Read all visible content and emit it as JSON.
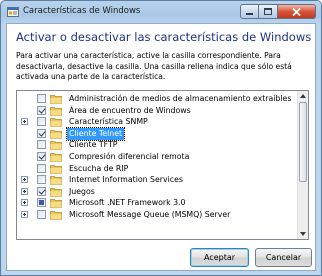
{
  "window": {
    "title": "Características de Windows",
    "controls": {
      "minimize": "minimize-icon",
      "maximize": "maximize-icon",
      "close": "close-icon"
    }
  },
  "heading": "Activar o desactivar las características de Windows",
  "description": {
    "line1": "Para activar una característica, active la casilla correspondiente. Para",
    "line2": "desactivarla, desactive la casilla. Una casilla rellena indica que sólo está",
    "line3": "activada una parte de la característica."
  },
  "features": [
    {
      "label": "Administración de medios de almacenamiento extraíbles",
      "state": "unchecked",
      "expandable": false,
      "selected": false
    },
    {
      "label": "Área de encuentro de Windows",
      "state": "checked",
      "expandable": false,
      "selected": false
    },
    {
      "label": "Característica SNMP",
      "state": "unchecked",
      "expandable": true,
      "selected": false
    },
    {
      "label": "Cliente Telnet",
      "state": "checked",
      "expandable": false,
      "selected": true
    },
    {
      "label": "Cliente TFTP",
      "state": "unchecked",
      "expandable": false,
      "selected": false
    },
    {
      "label": "Compresión diferencial remota",
      "state": "checked",
      "expandable": false,
      "selected": false
    },
    {
      "label": "Escucha de RIP",
      "state": "unchecked",
      "expandable": false,
      "selected": false
    },
    {
      "label": "Internet Information Services",
      "state": "unchecked",
      "expandable": true,
      "selected": false
    },
    {
      "label": "Juegos",
      "state": "checked",
      "expandable": true,
      "selected": false
    },
    {
      "label": "Microsoft .NET Framework 3.0",
      "state": "partial",
      "expandable": true,
      "selected": false
    },
    {
      "label": "Microsoft Message Queue (MSMQ) Server",
      "state": "unchecked",
      "expandable": true,
      "selected": false
    }
  ],
  "buttons": {
    "ok": "Aceptar",
    "cancel": "Cancelar"
  },
  "colors": {
    "heading": "#1e3287",
    "selection": "#3399ff",
    "folder": "#e8c45a"
  }
}
